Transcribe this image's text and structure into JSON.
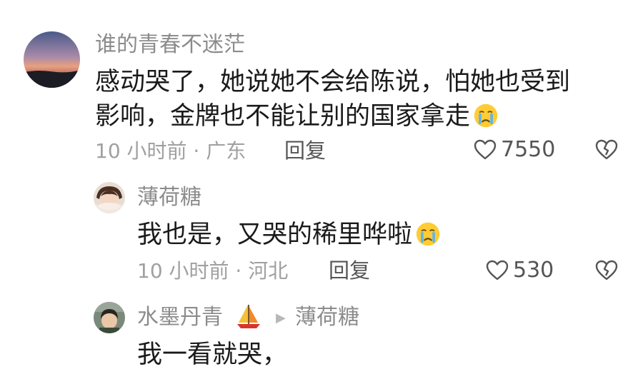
{
  "comments": [
    {
      "username": "谁的青春不迷茫",
      "text_line1": "感动哭了，她说她不会给陈说，怕她也受到",
      "text_line2": "影响，金牌也不能让别的国家拿走",
      "time_location": "10 小时前 · 广东",
      "reply_label": "回复",
      "likes": "7550",
      "emoji": "crying-face"
    },
    {
      "username": "薄荷糖",
      "text_line1": "我也是，又哭的稀里哗啦",
      "time_location": "10 小时前 · 河北",
      "reply_label": "回复",
      "likes": "530",
      "emoji": "crying-face"
    },
    {
      "username": "水墨丹青",
      "badge_icon": "sailboat",
      "reply_to": "薄荷糖",
      "text_line1": "我一看就哭，"
    }
  ],
  "icons": {
    "like": "heart-outline-icon",
    "dislike": "broken-heart-icon",
    "reply_arrow": "play-arrow-icon"
  },
  "colors": {
    "username": "#8c8c8c",
    "text": "#1a1a1a",
    "meta": "#a0a0a0"
  }
}
